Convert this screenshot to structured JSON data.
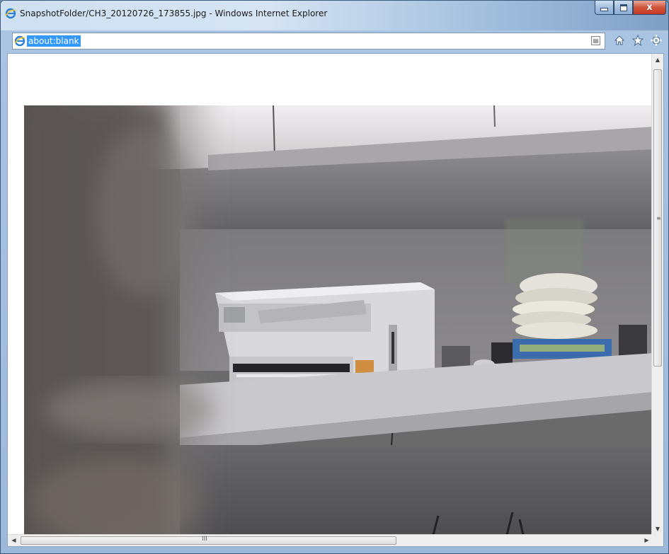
{
  "window": {
    "title": "SnapshotFolder/CH3_20120726_173855.jpg - Windows Internet Explorer",
    "buttons": {
      "minimize": "minimize",
      "maximize": "maximize",
      "close": "x"
    }
  },
  "address_bar": {
    "url": "about:blank",
    "page_icon": "ie-page-icon",
    "compat_icon": "compatibility-view-icon"
  },
  "toolbar_icons": [
    "home-icon",
    "favorites-star-icon",
    "tools-gear-icon"
  ],
  "scrollbars": {
    "vertical_grip": "≡",
    "horizontal_grip": "III",
    "arrow_up": "▲",
    "arrow_down": "▼",
    "arrow_left": "◀",
    "arrow_right": "▶"
  },
  "colors": {
    "selection": "#3399ff",
    "titlebar": "#cfe0f2",
    "close_button": "#c23a22"
  },
  "content": {
    "image_description_label": "Snapshot photo of printer and keyboards on shelf"
  }
}
